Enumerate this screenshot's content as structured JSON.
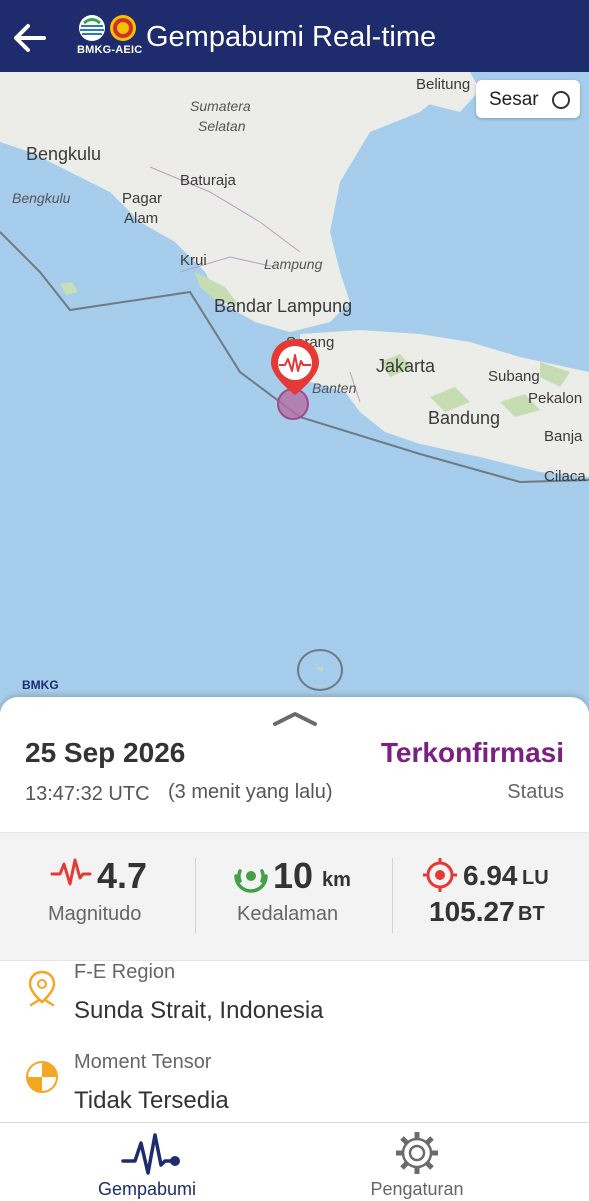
{
  "app_bar": {
    "title": "Gempabumi Real-time",
    "logo_text": "BMKG-AEIC"
  },
  "map": {
    "fault_toggle_label": "Sesar",
    "watermark_text": "BMKG",
    "labels": {
      "belitung": "Belitung",
      "sumatera": "Sumatera",
      "selatan": "Selatan",
      "bengkulu_city": "Bengkulu",
      "bengkulu_prov": "Bengkulu",
      "baturaja": "Baturaja",
      "pagar": "Pagar",
      "alam": "Alam",
      "krui": "Krui",
      "lampung": "Lampung",
      "bandar_lampung": "Bandar Lampung",
      "serang": "Serang",
      "jakarta": "Jakarta",
      "banten": "Banten",
      "subang": "Subang",
      "pekalongan": "Pekalon",
      "bandung": "Bandung",
      "banjar": "Banja",
      "cilacap": "Cilaca"
    }
  },
  "event": {
    "date": "25 Sep 2026",
    "time": "13:47:32 UTC",
    "ago": "(3 menit yang lalu)",
    "status_value": "Terkonfirmasi",
    "status_label": "Status",
    "magnitude": "4.7",
    "magnitude_label": "Magnitudo",
    "depth": "10",
    "depth_unit": "km",
    "depth_label": "Kedalaman",
    "latitude": "6.94",
    "latitude_unit": "LU",
    "longitude": "105.27",
    "longitude_unit": "BT",
    "region_label": "F-E Region",
    "region_value": "Sunda Strait, Indonesia",
    "moment_tensor_label": "Moment Tensor",
    "moment_tensor_value": "Tidak Tersedia"
  },
  "nav": {
    "items": [
      {
        "label": "Gempabumi",
        "icon": "seismograph-icon",
        "active": true
      },
      {
        "label": "Pengaturan",
        "icon": "gear-icon",
        "active": false
      }
    ]
  },
  "colors": {
    "app_bar": "#1e2b6d",
    "status": "#7b1f80",
    "magnitude_icon": "#e53935",
    "depth_icon": "#43a047",
    "location_icon": "#e53935",
    "info_icon": "#f5a623",
    "sea": "#a6cdeb",
    "land": "#ededea"
  }
}
